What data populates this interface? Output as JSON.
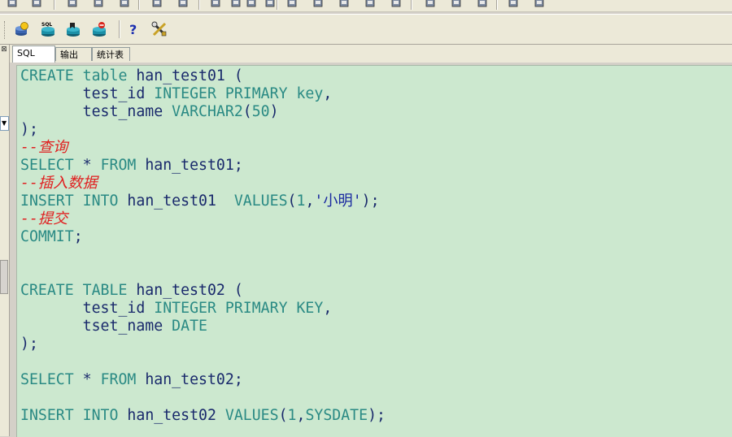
{
  "toolbar_top": {
    "icons": [
      "undo-icon",
      "redo-icon",
      "cut-icon",
      "copy-icon",
      "paste-icon",
      "find-icon",
      "goto-icon",
      "execute-icon",
      "dropdown-icon",
      "explain-icon",
      "dropdown-icon",
      "edit-icon",
      "indent-icon",
      "unindent-icon",
      "comment-icon",
      "uncomment-icon",
      "lock-icon",
      "lock-disabled-icon",
      "more-icon",
      "window-icon",
      "tile-icon"
    ]
  },
  "toolbar_main": {
    "buttons": [
      {
        "name": "db-connect-icon",
        "color": "#f5c518"
      },
      {
        "name": "sql-database-icon",
        "label": "SQL",
        "color": "#1b8fa6"
      },
      {
        "name": "db-bookmark-icon",
        "color": "#1b8fa6"
      },
      {
        "name": "db-disconnect-icon",
        "color": "#d9261c"
      },
      {
        "name": "help-icon",
        "label": "?",
        "color": "#1c2fb0"
      },
      {
        "name": "tools-icon",
        "color": "#c9a227"
      }
    ]
  },
  "tabs": [
    {
      "label": "SQL",
      "active": true
    },
    {
      "label": "输出",
      "active": false
    },
    {
      "label": "统计表",
      "active": false
    }
  ],
  "editor": {
    "background": "#cce8cf",
    "lines": [
      "CREATE table han_test01 (",
      "       test_id INTEGER PRIMARY key,",
      "       test_name VARCHAR2(50)",
      ");",
      "--查询",
      "SELECT * FROM han_test01;",
      "--插入数据",
      "INSERT INTO han_test01  VALUES(1,'小明');",
      "--提交",
      "COMMIT;",
      "",
      "",
      "CREATE TABLE han_test02 (",
      "       test_id INTEGER PRIMARY KEY,",
      "       tset_name DATE",
      ");",
      "",
      "SELECT * FROM han_test02;",
      "",
      "INSERT INTO han_test02 VALUES(1,SYSDATE);"
    ]
  },
  "colors": {
    "keyword": "#2a8a84",
    "identifier": "#1a2a6c",
    "comment": "#e02020",
    "string": "#1a2aa0"
  }
}
